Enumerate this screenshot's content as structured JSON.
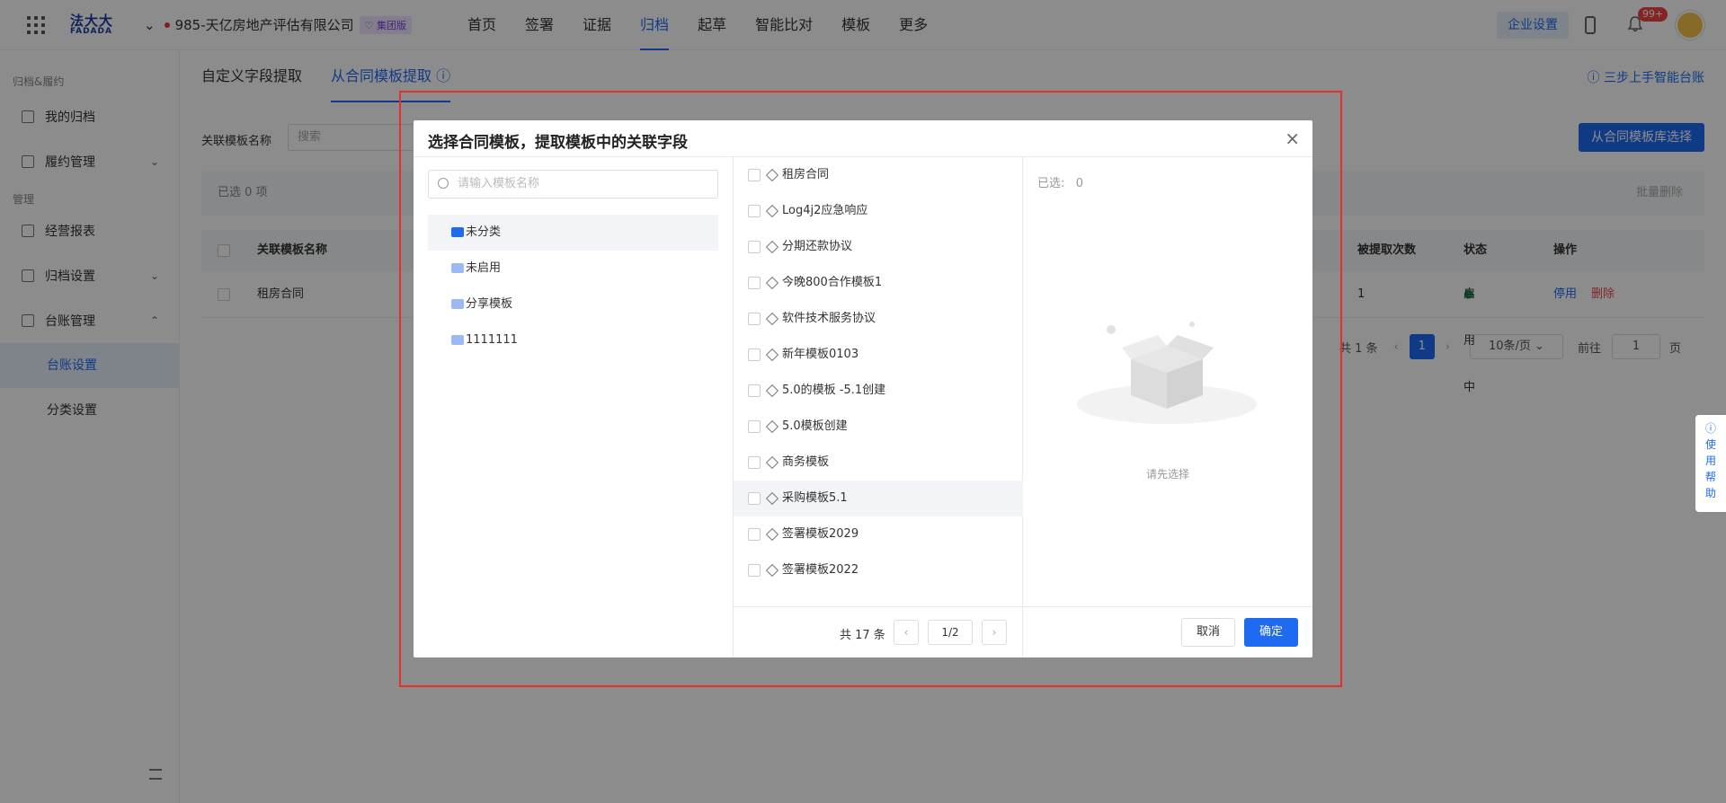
{
  "topbar": {
    "logo_cn": "法大大",
    "logo_en": "FADADA",
    "company": "985-天亿房地产评估有限公司",
    "edition_badge": "集团版",
    "nav": [
      "首页",
      "签署",
      "证据",
      "归档",
      "起草",
      "智能比对",
      "模板",
      "更多"
    ],
    "active_nav": "归档",
    "enterprise_settings": "企业设置",
    "notification_count": "99+"
  },
  "sidebar": {
    "group1": "归档&履约",
    "my_archive": "我的归档",
    "performance": "履约管理",
    "group2": "管理",
    "reports": "经营报表",
    "archive_settings": "归档设置",
    "ledger_mgmt": "台账管理",
    "ledger_settings": "台账设置",
    "category_settings": "分类设置"
  },
  "main": {
    "tab_custom": "自定义字段提取",
    "tab_template": "从合同模板提取",
    "guide_link": "三步上手智能台账",
    "filter_label": "关联模板名称",
    "filter_placeholder": "搜索",
    "lib_button": "从合同模板库选择",
    "selected_count": "已选 0 项",
    "batch_delete": "批量删除",
    "columns": {
      "name": "关联模板名称",
      "times": "被提取次数",
      "status": "状态",
      "action": "操作"
    },
    "row": {
      "name": "租房合同",
      "times": "1",
      "status": "启用中",
      "disable": "停用",
      "delete": "删除"
    },
    "pager": {
      "total": "共 1 条",
      "current": "1",
      "page_size": "10条/页",
      "goto_label": "前往",
      "goto_value": "1",
      "page_unit": "页"
    }
  },
  "help_tab": "使用帮助",
  "modal": {
    "title": "选择合同模板，提取模板中的关联字段",
    "search_placeholder": "请输入模板名称",
    "folders": [
      "未分类",
      "未启用",
      "分享模板",
      "1111111"
    ],
    "templates": [
      "租房合同",
      "Log4j2应急响应",
      "分期还款协议",
      "今晚800合作模板1",
      "软件技术服务协议",
      "新年模板0103",
      "5.0的模板 -5.1创建",
      "5.0模板创建",
      "商务模板",
      "采购模板5.1",
      "签署模板2029",
      "签署模板2022"
    ],
    "total": "共 17 条",
    "page": "1/2",
    "selected_label": "已选:",
    "selected_count": "0",
    "empty_text": "请先选择",
    "cancel": "取消",
    "confirm": "确定"
  }
}
